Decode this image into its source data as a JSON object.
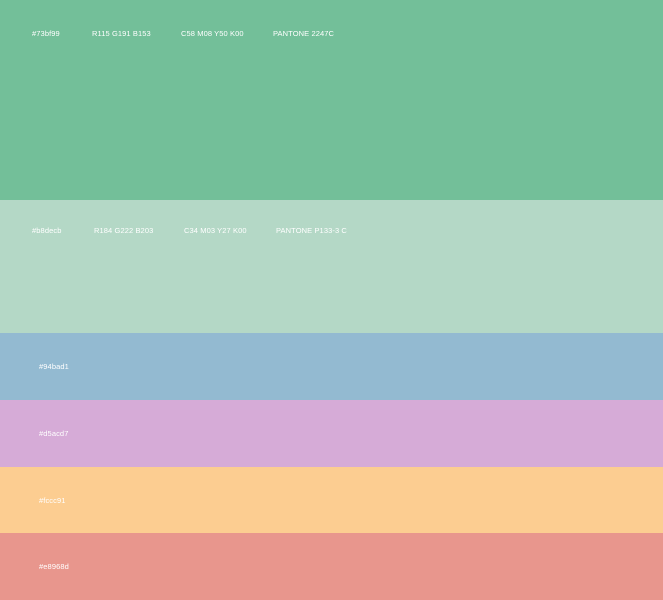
{
  "swatches": [
    {
      "hex": "#73bf99",
      "rgb": "R115  G191  B153",
      "cmyk": "C58  M08  Y50  K00",
      "pantone": "PANTONE  2247C",
      "color": "#73bf99"
    },
    {
      "hex": "#b8decb",
      "rgb": "R184  G222  B203",
      "cmyk": "C34  M03  Y27  K00",
      "pantone": "PANTONE  P133-3 C",
      "color": "#b4d8c6"
    },
    {
      "hex": "#94bad1",
      "color": "#93bad1"
    },
    {
      "hex": "#d5acd7",
      "color": "#d6abd7"
    },
    {
      "hex": "#fccc91",
      "color": "#fccd91"
    },
    {
      "hex": "#e8968d",
      "color": "#e8968d"
    }
  ]
}
